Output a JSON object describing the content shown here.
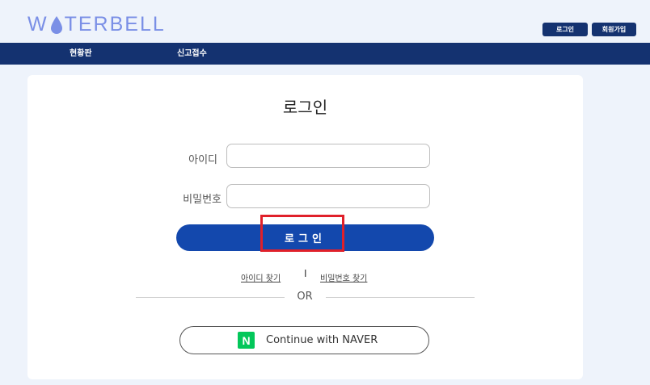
{
  "header": {
    "logo_left": "W",
    "logo_right": "TERBELL",
    "login_button": "로그인",
    "signup_button": "회원가입"
  },
  "nav": {
    "items": [
      {
        "label": "현황판"
      },
      {
        "label": "신고접수"
      }
    ]
  },
  "login_form": {
    "title": "로그인",
    "id_label": "아이디",
    "id_value": "",
    "password_label": "비밀번호",
    "password_value": "",
    "submit_label": "로그인",
    "find_id": "아이디 찾기",
    "separator": "I",
    "find_password": "비밀번호 찾기",
    "or_text": "OR",
    "naver": {
      "logo_letter": "N",
      "label": "Continue with NAVER"
    }
  },
  "colors": {
    "brand_navy": "#143270",
    "primary_button": "#1348ad",
    "logo": "#7a8fe6",
    "naver_green": "#03c75a",
    "highlight_box": "#e0202a"
  },
  "icons": {
    "logo_drop": "water-drop-icon",
    "naver": "naver-logo-icon"
  }
}
